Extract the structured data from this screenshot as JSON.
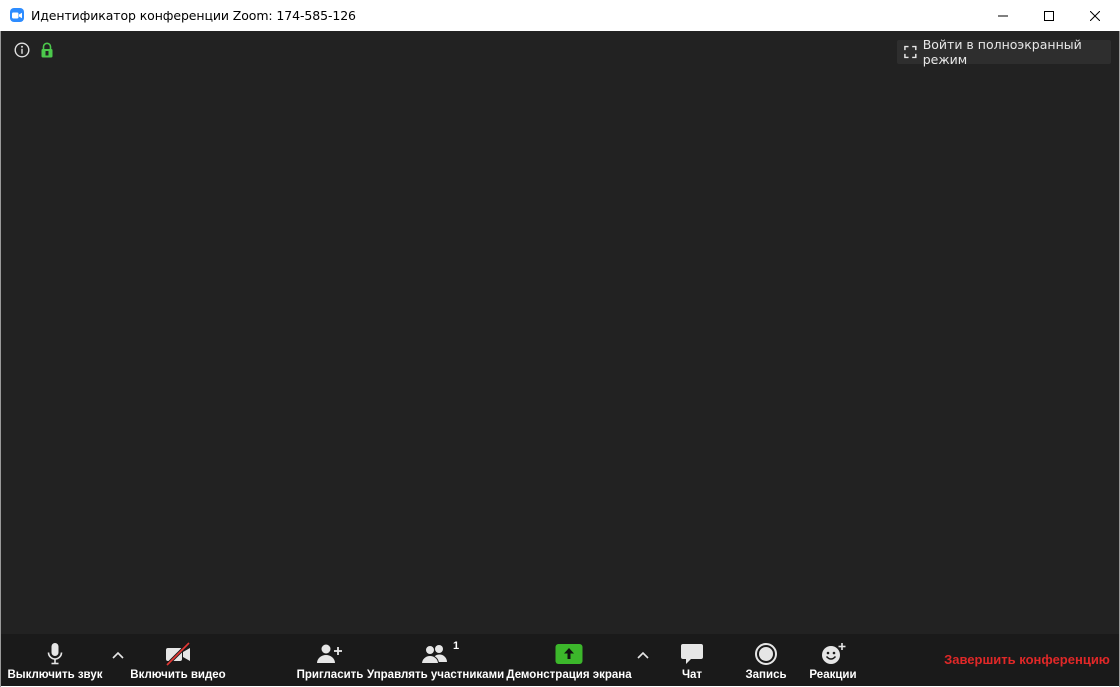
{
  "window": {
    "title": "Идентификатор конференции Zoom: 174-585-126"
  },
  "meeting": {
    "fullscreen_label": "Войти в полноэкранный режим"
  },
  "toolbar": {
    "mute_label": "Выключить звук",
    "video_label": "Включить видео",
    "invite_label": "Пригласить",
    "participants_label": "Управлять участниками",
    "participants_count": "1",
    "share_label": "Демонстрация экрана",
    "chat_label": "Чат",
    "record_label": "Запись",
    "reactions_label": "Реакции",
    "end_label": "Завершить конференцию"
  },
  "colors": {
    "accent_blue": "#2d8cff",
    "share_green": "#3cb72b",
    "lock_green": "#4cc94c",
    "end_red": "#e02828",
    "video_off_red": "#e53935"
  }
}
